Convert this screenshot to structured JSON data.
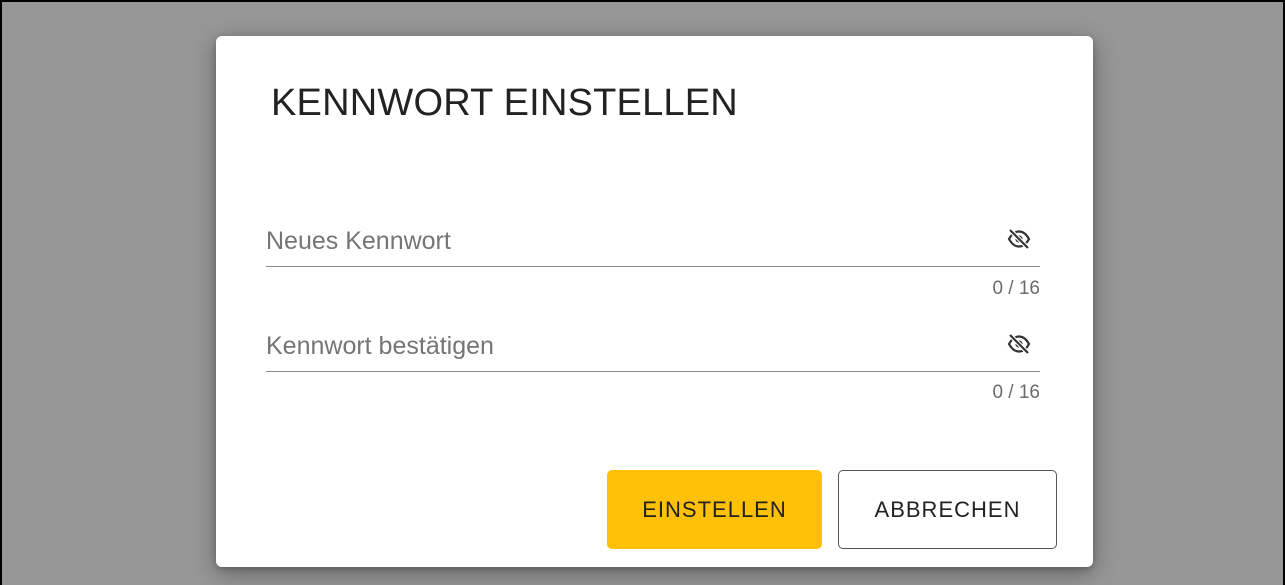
{
  "dialog": {
    "title": "KENNWORT EINSTELLEN",
    "fields": [
      {
        "placeholder": "Neues Kennwort",
        "value": "",
        "counter": "0 / 16",
        "icon": "eye-off-icon"
      },
      {
        "placeholder": "Kennwort bestätigen",
        "value": "",
        "counter": "0 / 16",
        "icon": "eye-off-icon"
      }
    ],
    "buttons": {
      "confirm_label": "EINSTELLEN",
      "cancel_label": "ABBRECHEN"
    }
  },
  "colors": {
    "backdrop": "#979797",
    "dialog_background": "#ffffff",
    "primary_button": "#ffc107",
    "text": "#222222"
  }
}
